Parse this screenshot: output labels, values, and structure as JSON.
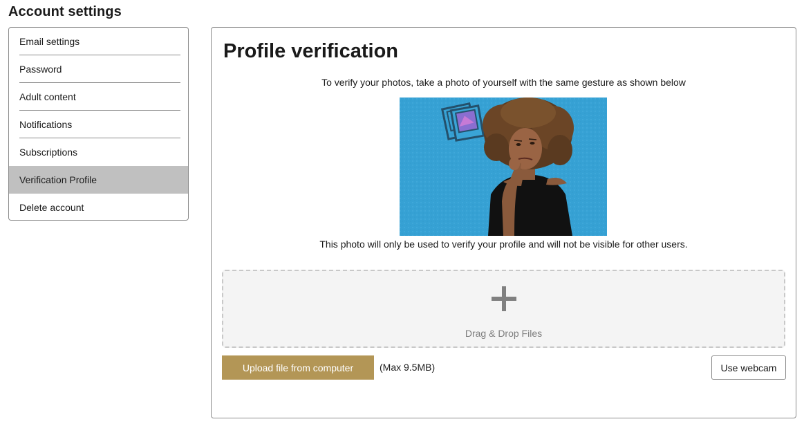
{
  "page": {
    "title": "Account settings"
  },
  "sidebar": {
    "items": [
      {
        "label": "Email settings",
        "active": false
      },
      {
        "label": "Password",
        "active": false
      },
      {
        "label": "Adult content",
        "active": false
      },
      {
        "label": "Notifications",
        "active": false
      },
      {
        "label": "Subscriptions",
        "active": false
      },
      {
        "label": "Verification Profile",
        "active": true
      },
      {
        "label": "Delete account",
        "active": false
      }
    ]
  },
  "main": {
    "title": "Profile verification",
    "instructions": "To verify your photos, take a photo of yourself with the same gesture as shown below",
    "privacy_note": "This photo will only be used to verify your profile and will not be visible for other users.",
    "dropzone": {
      "icon": "plus-icon",
      "label": "Drag & Drop Files"
    },
    "upload_button": "Upload file from computer",
    "max_size": "(Max 9.5MB)",
    "webcam_button": "Use webcam"
  },
  "colors": {
    "accent": "#b39656",
    "active_item_bg": "#c0c0c0",
    "photo_bg": "#3aa4d6"
  }
}
